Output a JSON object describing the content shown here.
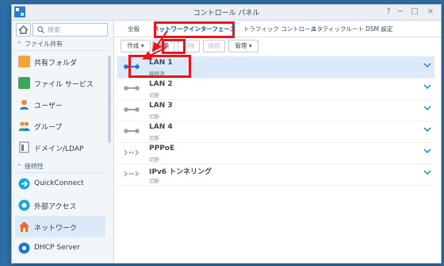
{
  "window": {
    "title": "コントロール パネル",
    "controls": [
      "?",
      "−",
      "□",
      "×"
    ]
  },
  "sidebar": {
    "search_placeholder": "検索",
    "sections": [
      {
        "label": "ファイル共有"
      },
      {
        "label": "接続性"
      }
    ],
    "items": [
      {
        "label": "共有フォルダ",
        "icon": "shared-folder-icon",
        "color": "#f2a33a"
      },
      {
        "label": "ファイル サービス",
        "icon": "file-services-icon",
        "color": "#3aa757"
      },
      {
        "label": "ユーザー",
        "icon": "user-icon",
        "color": "#e98a3c"
      },
      {
        "label": "グループ",
        "icon": "group-icon",
        "color": "#e98a3c"
      },
      {
        "label": "ドメイン/LDAP",
        "icon": "domain-icon",
        "color": "#6d7c8c"
      },
      {
        "label": "QuickConnect",
        "icon": "quickconnect-icon",
        "color": "#1fa7d4"
      },
      {
        "label": "外部アクセス",
        "icon": "external-access-icon",
        "color": "#1fa7d4"
      },
      {
        "label": "ネットワーク",
        "icon": "network-icon",
        "color": "#e66a2c"
      },
      {
        "label": "DHCP Server",
        "icon": "dhcp-server-icon",
        "color": "#1f79c9"
      }
    ]
  },
  "tabs": [
    {
      "label": "全般"
    },
    {
      "label": "ネットワークインターフェース"
    },
    {
      "label": "トラフィック コントロール"
    },
    {
      "label": "スタティックルート"
    },
    {
      "label": "DSM 設定"
    }
  ],
  "toolbar": {
    "create": "作成",
    "edit": "編集",
    "delete": "削除",
    "connect": "接続",
    "manage": "管理"
  },
  "interfaces": [
    {
      "name": "LAN 1",
      "status": "接続済",
      "connected": true,
      "type": "lan"
    },
    {
      "name": "LAN 2",
      "status": "切断",
      "connected": false,
      "type": "lan"
    },
    {
      "name": "LAN 3",
      "status": "切断",
      "connected": false,
      "type": "lan"
    },
    {
      "name": "LAN 4",
      "status": "切断",
      "connected": false,
      "type": "lan"
    },
    {
      "name": "PPPoE",
      "status": "切断",
      "connected": false,
      "type": "pppoe"
    },
    {
      "name": "IPv6 トンネリング",
      "status": "切断",
      "connected": false,
      "type": "tunnel"
    }
  ],
  "colors": {
    "accent": "#1f79c9",
    "highlight": "#e8151b",
    "connected_icon": "#1f79c9",
    "disconnected_icon": "#9aa3ad"
  }
}
